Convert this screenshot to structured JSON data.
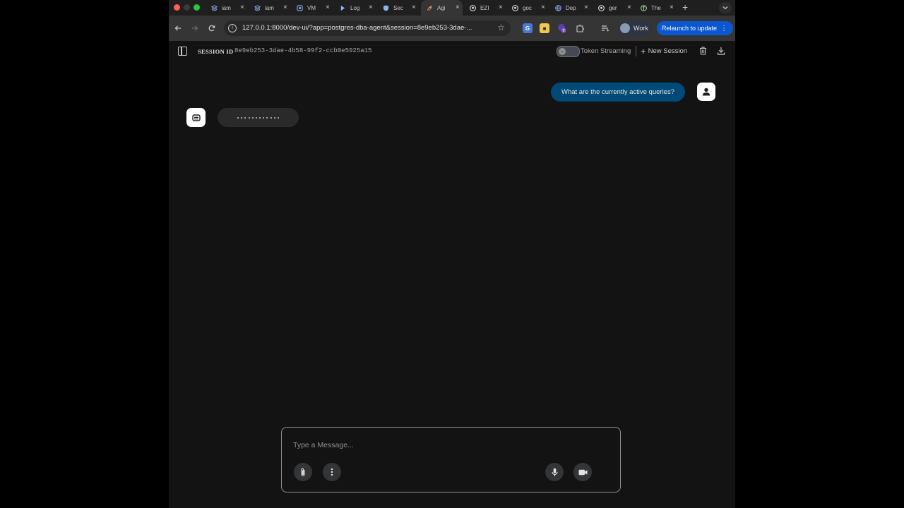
{
  "browser": {
    "tabs": [
      {
        "title": "iam",
        "icon": "stack-icon",
        "active": false
      },
      {
        "title": "iam",
        "icon": "stack-icon",
        "active": false
      },
      {
        "title": "VM",
        "icon": "vm-icon",
        "active": false
      },
      {
        "title": "Log",
        "icon": "logs-icon",
        "active": false
      },
      {
        "title": "Sec",
        "icon": "shield-icon",
        "active": false
      },
      {
        "title": "Agi",
        "icon": "agent-icon",
        "active": true
      },
      {
        "title": "EZI",
        "icon": "github-icon",
        "active": false
      },
      {
        "title": "goc",
        "icon": "github-icon",
        "active": false
      },
      {
        "title": "Dep",
        "icon": "globe-icon",
        "active": false
      },
      {
        "title": "ger",
        "icon": "github-icon",
        "active": false
      },
      {
        "title": "The",
        "icon": "site-icon",
        "active": false
      }
    ],
    "url": "127.0.0.1:8000/dev-ui/?app=postgres-dba-agent&session=8e9eb253-3dae-...",
    "extension_badge": "7",
    "profile_label": "Work",
    "relaunch_label": "Relaunch to update"
  },
  "header": {
    "session_label": "SESSION ID",
    "session_id": "8e9eb253-3dae-4b58-99f2-ccb0e5925a15",
    "token_streaming_label": "Token Streaming",
    "token_streaming_enabled": false,
    "new_session_label": "New Session"
  },
  "chat": {
    "user_message": "What are the currently active queries?",
    "bot_status": "thinking"
  },
  "composer": {
    "placeholder": "Type a Message...",
    "value": ""
  },
  "colors": {
    "accent": "#004a77",
    "relaunch": "#0b57d0",
    "background": "#131314"
  }
}
